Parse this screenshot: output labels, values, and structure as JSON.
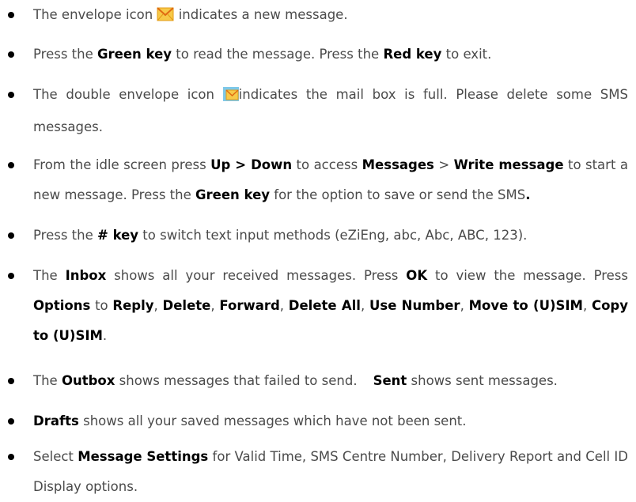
{
  "items": [
    {
      "parts": [
        "The envelope icon ",
        " indicates a new message."
      ]
    },
    {
      "p1": "Press the ",
      "k1": "Green key",
      "p2": " to read the message. Press the ",
      "k2": "Red key",
      "p3": " to exit."
    },
    {
      "p1": "The double envelope icon ",
      "p2": "indicates the mail box is full. Please delete some SMS messages."
    },
    {
      "p1": "From the idle screen press ",
      "k1": "Up > Down",
      "p2": " to access ",
      "k2": "Messages",
      "p3": " > ",
      "k3": "Write message",
      "p4": " to start a new message. Press the ",
      "k4": "Green key",
      "p5": " for the option to save or send the SMS",
      "k5": "."
    },
    {
      "p1": "Press the ",
      "k1": "# key",
      "p2": " to switch text input methods (eZiEng, abc, Abc, ABC, 123)."
    },
    {
      "p1": "The ",
      "k1": "Inbox",
      "p2": " shows all your received messages. Press ",
      "k2": "OK",
      "p3": " to view the message. Press ",
      "k3": "Options",
      "p4": " to ",
      "k4": "Reply",
      "p5": ", ",
      "k5": "Delete",
      "p6": ", ",
      "k6": "Forward",
      "p7": ", ",
      "k7": "Delete All",
      "p8": ", ",
      "k8": "Use Number",
      "p9": ", ",
      "k9": "Move to (U)SIM",
      "p10": ", ",
      "k10": "Copy to (U)SIM",
      "p11": "."
    },
    {
      "p1": "The ",
      "k1": "Outbox",
      "p2": " shows messages that failed to send.",
      "k2": "Sent",
      "p3": " shows sent messages."
    },
    {
      "k1": "Drafts",
      "p1": " shows all your saved messages which have not been sent."
    },
    {
      "p1": "Select ",
      "k1": "Message Settings",
      "p2": " for Valid Time, SMS Centre Number, Delivery Report and Cell ID Display options."
    }
  ],
  "icons": {
    "envelope": "envelope-icon",
    "double_envelope": "double-envelope-icon"
  }
}
